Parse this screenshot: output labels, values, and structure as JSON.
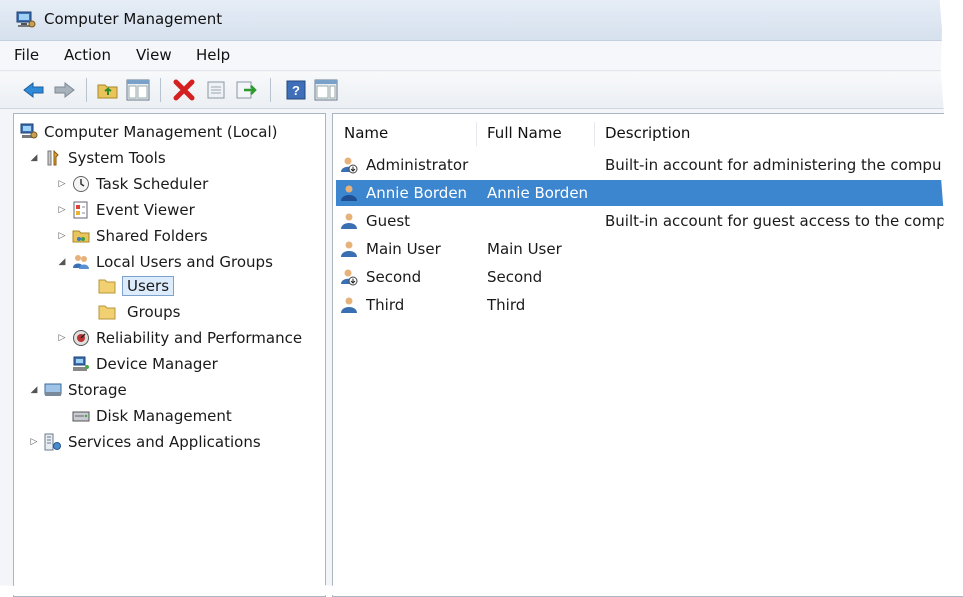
{
  "window": {
    "title": "Computer Management"
  },
  "menu": [
    "File",
    "Action",
    "View",
    "Help"
  ],
  "toolbar": {
    "buttons": [
      "back-icon",
      "forward-icon",
      "up-folder-icon",
      "show-hide-tree-icon",
      "delete-icon",
      "properties-icon",
      "export-list-icon",
      "help-icon",
      "show-hide-action-pane-icon"
    ]
  },
  "tree": {
    "root": "Computer Management (Local)",
    "system_tools": "System Tools",
    "task_scheduler": "Task Scheduler",
    "event_viewer": "Event Viewer",
    "shared_folders": "Shared Folders",
    "local_users_groups": "Local Users and Groups",
    "users": "Users",
    "groups": "Groups",
    "reliability": "Reliability and Performance",
    "device_manager": "Device Manager",
    "storage": "Storage",
    "disk_management": "Disk Management",
    "services": "Services and Applications"
  },
  "list": {
    "columns": [
      "Name",
      "Full Name",
      "Description"
    ],
    "rows": [
      {
        "name": "Administrator",
        "full_name": "",
        "description": "Built-in account for administering the compu",
        "disabled": true
      },
      {
        "name": "Annie Borden",
        "full_name": "Annie Borden",
        "description": "",
        "selected": true
      },
      {
        "name": "Guest",
        "full_name": "",
        "description": "Built-in account for guest access to the comp"
      },
      {
        "name": "Main User",
        "full_name": "Main User",
        "description": ""
      },
      {
        "name": "Second",
        "full_name": "Second",
        "description": "",
        "disabled": true
      },
      {
        "name": "Third",
        "full_name": "Third",
        "description": ""
      }
    ]
  },
  "colors": {
    "selection": "#3c86cf",
    "tree_selection": "#dcecfc"
  }
}
